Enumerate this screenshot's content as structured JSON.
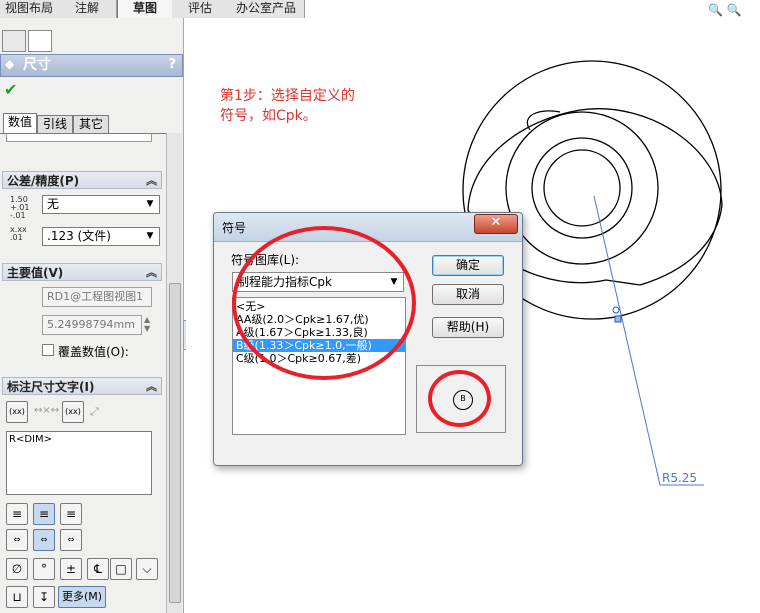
{
  "top_tabs": [
    "视图布局",
    "注解",
    "草图",
    "评估",
    "办公室产品"
  ],
  "top_tabs_active": 2,
  "panel": {
    "title": "尺寸",
    "help": "?",
    "subtabs": [
      "数值",
      "引线",
      "其它"
    ],
    "tolerance": {
      "heading": "公差/精度(P)",
      "tol_value": "无",
      "precision": ".123 (文件)",
      "icon_tol": "1.50 +.01 -.01",
      "icon_prec": "x.xx .01"
    },
    "primary": {
      "heading": "主要值(V)",
      "name_field": "RD1@工程图视图1",
      "value_field": "5.24998794mm",
      "override_label": "覆盖数值(O):"
    },
    "dim_text": {
      "heading": "标注尺寸文字(I)",
      "xx": "(xx)",
      "text_content": "R<DIM>",
      "more": "更多(M)"
    }
  },
  "annotation": {
    "line1": "第1步：选择自定义的",
    "line2": "符号，如Cpk。"
  },
  "dialog": {
    "title": "符号",
    "close": "✕",
    "library_label": "符号图库(L):",
    "library_value": "制程能力指标Cpk",
    "items": [
      "<无>",
      "AA级(2.0＞Cpk≥1.67,优)",
      "A级(1.67＞Cpk≥1.33,良)",
      "B级(1.33＞Cpk≥1.0,一般)",
      "C级(1.0＞Cpk≥0.67,差)"
    ],
    "selected_index": 3,
    "buttons": {
      "ok": "确定",
      "cancel": "取消",
      "help": "帮助(H)"
    },
    "preview_symbol": "B"
  },
  "drawing": {
    "dimension_label": "R5.25"
  },
  "colors": {
    "annotation": "#e0332a",
    "highlight": "#e8202a",
    "dimension": "#4a7ad0",
    "selection": "#3399ff"
  }
}
